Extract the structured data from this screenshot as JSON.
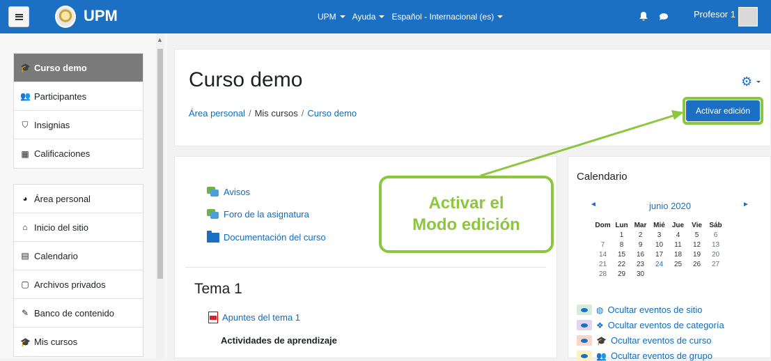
{
  "navbar": {
    "brand": "UPM",
    "menu": [
      {
        "label": "UPM"
      },
      {
        "label": "Ayuda"
      },
      {
        "label": "Español - Internacional (es)"
      }
    ],
    "user": "Profesor 1"
  },
  "sidebar": {
    "course_items": [
      {
        "label": "Curso demo",
        "icon": "graduation-cap-icon"
      },
      {
        "label": "Participantes",
        "icon": "users-icon"
      },
      {
        "label": "Insignias",
        "icon": "shield-icon"
      },
      {
        "label": "Calificaciones",
        "icon": "table-icon"
      }
    ],
    "site_items": [
      {
        "label": "Área personal",
        "icon": "dashboard-icon"
      },
      {
        "label": "Inicio del sitio",
        "icon": "home-icon"
      },
      {
        "label": "Calendario",
        "icon": "calendar-icon"
      },
      {
        "label": "Archivos privados",
        "icon": "file-icon"
      },
      {
        "label": "Banco de contenido",
        "icon": "paint-brush-icon"
      },
      {
        "label": "Mis cursos",
        "icon": "graduation-cap-icon"
      }
    ]
  },
  "header": {
    "title": "Curso demo",
    "breadcrumb": [
      "Área personal",
      "Mis cursos",
      "Curso demo"
    ],
    "edit_button": "Activar edición"
  },
  "course": {
    "resources": [
      {
        "label": "Avisos",
        "icon": "forum-icon"
      },
      {
        "label": "Foro de la asignatura",
        "icon": "forum-icon"
      },
      {
        "label": "Documentación del curso",
        "icon": "folder-icon"
      }
    ],
    "section_title": "Tema 1",
    "section_resource": {
      "label": "Apuntes del tema 1",
      "icon": "pdf-icon"
    },
    "section_label": "Actividades de aprendizaje"
  },
  "calendar": {
    "title": "Calendario",
    "month": "junio 2020",
    "weekdays": [
      "Dom",
      "Lun",
      "Mar",
      "Mié",
      "Jue",
      "Vie",
      "Sáb"
    ],
    "weeks": [
      [
        "",
        "1",
        "2",
        "3",
        "4",
        "5",
        "6"
      ],
      [
        "7",
        "8",
        "9",
        "10",
        "11",
        "12",
        "13"
      ],
      [
        "14",
        "15",
        "16",
        "17",
        "18",
        "19",
        "20"
      ],
      [
        "21",
        "22",
        "23",
        "24",
        "25",
        "26",
        "27"
      ],
      [
        "28",
        "29",
        "30",
        "",
        "",
        "",
        ""
      ]
    ],
    "today": "24",
    "events": [
      {
        "label": "Ocultar eventos de sitio",
        "color": "#d4edda",
        "icon": "globe-icon"
      },
      {
        "label": "Ocultar eventos de categoría",
        "color": "#e2d4f0",
        "icon": "cubes-icon"
      },
      {
        "label": "Ocultar eventos de curso",
        "color": "#f8d7c9",
        "icon": "graduation-cap-icon"
      },
      {
        "label": "Ocultar eventos de grupo",
        "color": "#fff0c2",
        "icon": "users-icon"
      }
    ]
  },
  "callout": {
    "line1": "Activar el",
    "line2": "Modo edición",
    "color": "#8cc63f"
  },
  "colors": {
    "navbar": "#1c70c4",
    "link": "#0f6cbf",
    "active_nav": "#7a7a7a"
  }
}
